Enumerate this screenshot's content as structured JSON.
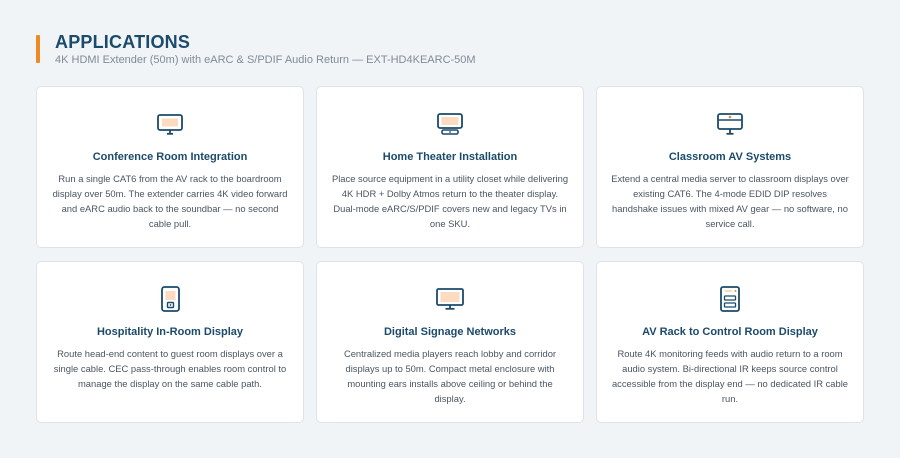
{
  "header": {
    "title": "APPLICATIONS",
    "subtitle": "4K HDMI Extender (50m) with eARC & S/PDIF Audio Return — EXT-HD4KEARC-50M",
    "accent_color": "#ee8a23"
  },
  "cards": [
    {
      "icon": "monitor-icon",
      "title": "Conference Room Integration",
      "text": "Run a single CAT6 from the AV rack to the boardroom display over 50m. The extender carries 4K video forward and eARC audio back to the soundbar — no second cable pull."
    },
    {
      "icon": "tv-soundbar-icon",
      "title": "Home Theater Installation",
      "text": "Place source equipment in a utility closet while delivering 4K HDR + Dolby Atmos return to the theater display. Dual-mode eARC/S/PDIF covers new and legacy TVs in one SKU."
    },
    {
      "icon": "presentation-screen-icon",
      "title": "Classroom AV Systems",
      "text": "Extend a central media server to classroom displays over existing CAT6. The 4-mode EDID DIP resolves handshake issues with mixed AV gear — no software, no service call."
    },
    {
      "icon": "tablet-icon",
      "title": "Hospitality In-Room Display",
      "text": "Route head-end content to guest room displays over a single cable. CEC pass-through enables room control to manage the display on the same cable path."
    },
    {
      "icon": "signage-display-icon",
      "title": "Digital Signage Networks",
      "text": "Centralized media players reach lobby and corridor displays up to 50m. Compact metal enclosure with mounting ears installs above ceiling or behind the display."
    },
    {
      "icon": "server-rack-icon",
      "title": "AV Rack to Control Room Display",
      "text": "Route 4K monitoring feeds with audio return to a room audio system. Bi-directional IR keeps source control accessible from the display end — no dedicated IR cable run."
    }
  ]
}
